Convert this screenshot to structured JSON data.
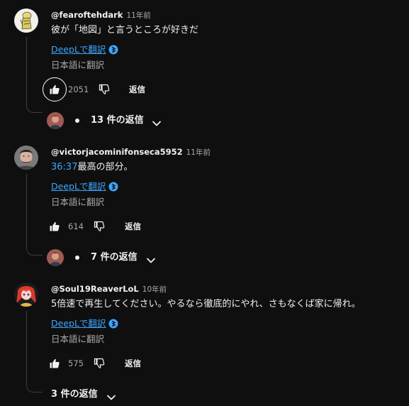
{
  "comments": [
    {
      "author": "@fearoftehdark",
      "time": "11年前",
      "text": "彼が「地図」と言うところが好きだ",
      "deepl": "DeepLで翻訳",
      "translate": "日本語に翻訳",
      "likes": "2051",
      "reply": "返信",
      "replies": "13 件の返信",
      "avatar": "cartoon-figure-avatar"
    },
    {
      "author": "@victorjacominifonseca5952",
      "time": "11年前",
      "timestamp": "36:37",
      "text": "最高の部分。",
      "deepl": "DeepLで翻訳",
      "translate": "日本語に翻訳",
      "likes": "614",
      "reply": "返信",
      "replies": "7 件の返信",
      "avatar": "man-portrait-avatar"
    },
    {
      "author": "@Soul19ReaverLoL",
      "time": "10年前",
      "text": "5倍速で再生してください。やるなら徹底的にやれ、さもなくば家に帰れ。",
      "deepl": "DeepLで翻訳",
      "translate": "日本語に翻訳",
      "likes": "575",
      "reply": "返信",
      "replies": "3 件の返信",
      "avatar": "anime-character-avatar"
    }
  ],
  "colors": {
    "background": "#0f0f0f",
    "link": "#3ea6ff",
    "text": "#f1f1f1",
    "muted": "#aaaaaa"
  }
}
